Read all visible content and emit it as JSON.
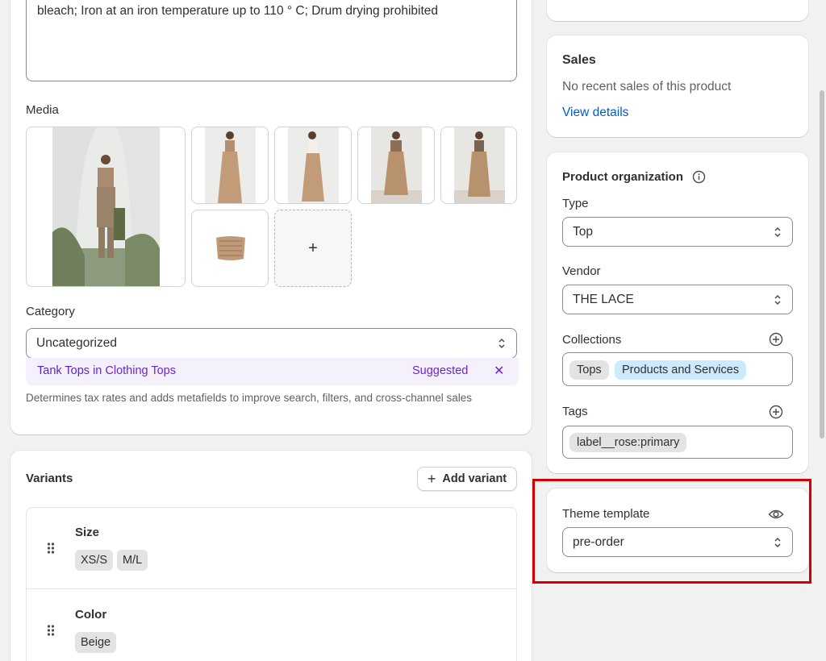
{
  "description": {
    "text": "bleach; Iron at an iron temperature up to 110 ° C; Drum drying prohibited"
  },
  "media": {
    "heading": "Media",
    "add_label": "+"
  },
  "category": {
    "heading": "Category",
    "value": "Uncategorized",
    "suggestion_name": "Tank Tops",
    "suggestion_in": "in Clothing Tops",
    "suggestion_tag": "Suggested",
    "dismiss": "✕",
    "help": "Determines tax rates and adds metafields to improve search, filters, and cross-channel sales"
  },
  "variants": {
    "heading": "Variants",
    "add_label": "Add variant",
    "options": [
      {
        "name": "Size",
        "values": [
          "XS/S",
          "M/L"
        ]
      },
      {
        "name": "Color",
        "values": [
          "Beige"
        ]
      }
    ]
  },
  "sales": {
    "heading": "Sales",
    "status": "No recent sales of this product",
    "link": "View details"
  },
  "organization": {
    "heading": "Product organization",
    "type_label": "Type",
    "type_value": "Top",
    "vendor_label": "Vendor",
    "vendor_value": "THE LACE",
    "collections_label": "Collections",
    "collections": [
      "Tops",
      "Products and Services"
    ],
    "tags_label": "Tags",
    "tags": [
      "label__rose:primary"
    ]
  },
  "theme": {
    "label": "Theme template",
    "value": "pre-order"
  },
  "colors": {
    "highlight": "#d40000",
    "link": "#005bd3",
    "suggest": "#6b25d1"
  }
}
